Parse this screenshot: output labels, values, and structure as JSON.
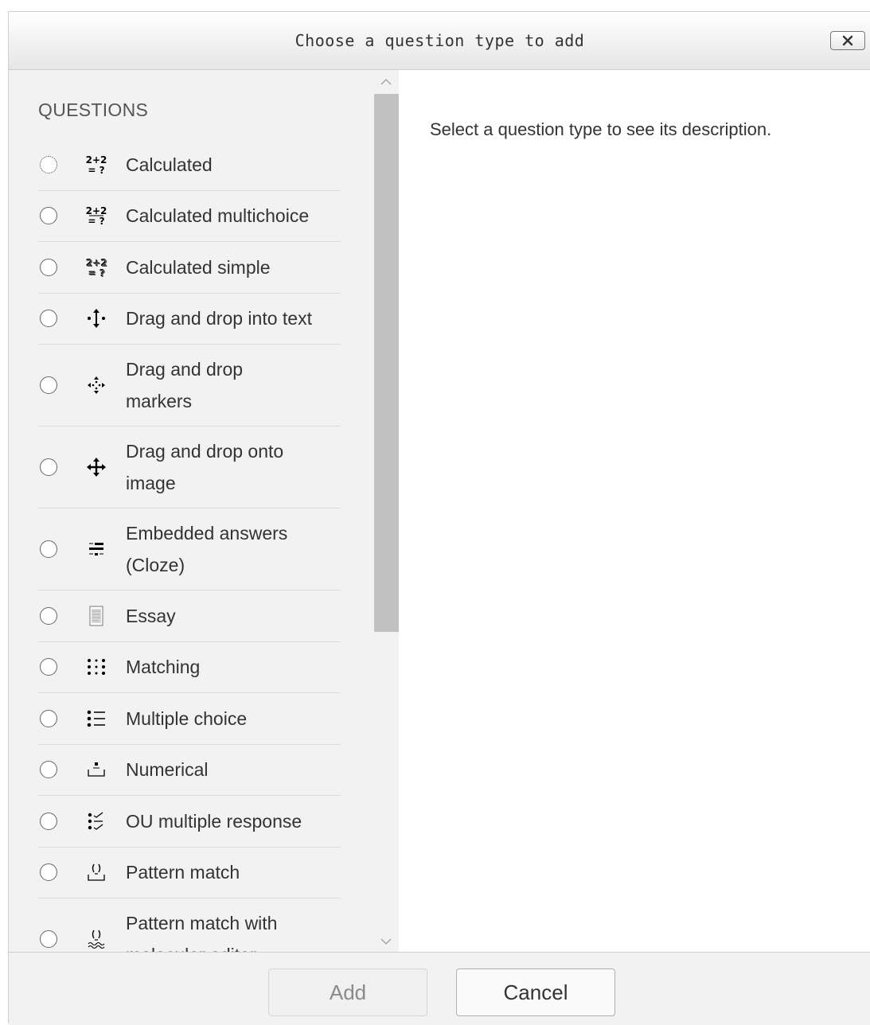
{
  "dialog": {
    "title": "Choose a question type to add",
    "close_label": "×"
  },
  "questions": {
    "heading": "QUESTIONS",
    "items": [
      {
        "label": "Calculated",
        "icon": "calculated-icon"
      },
      {
        "label": "Calculated multichoice",
        "icon": "calculated-multichoice-icon"
      },
      {
        "label": "Calculated simple",
        "icon": "calculated-simple-icon"
      },
      {
        "label": "Drag and drop into text",
        "icon": "drag-drop-text-icon"
      },
      {
        "label": "Drag and drop markers",
        "icon": "drag-drop-markers-icon"
      },
      {
        "label": "Drag and drop onto image",
        "icon": "drag-drop-image-icon"
      },
      {
        "label": "Embedded answers (Cloze)",
        "icon": "cloze-icon"
      },
      {
        "label": "Essay",
        "icon": "essay-icon"
      },
      {
        "label": "Matching",
        "icon": "matching-icon"
      },
      {
        "label": "Multiple choice",
        "icon": "multiple-choice-icon"
      },
      {
        "label": "Numerical",
        "icon": "numerical-icon"
      },
      {
        "label": "OU multiple response",
        "icon": "ou-multiple-response-icon"
      },
      {
        "label": "Pattern match",
        "icon": "pattern-match-icon"
      },
      {
        "label": "Pattern match with molecular editor",
        "icon": "pattern-match-molecular-icon"
      }
    ],
    "icon_text": {
      "calc_top": "2+2",
      "calc_bottom": "= ?"
    }
  },
  "description": {
    "placeholder": "Select a question type to see its description."
  },
  "footer": {
    "add_label": "Add",
    "cancel_label": "Cancel"
  }
}
